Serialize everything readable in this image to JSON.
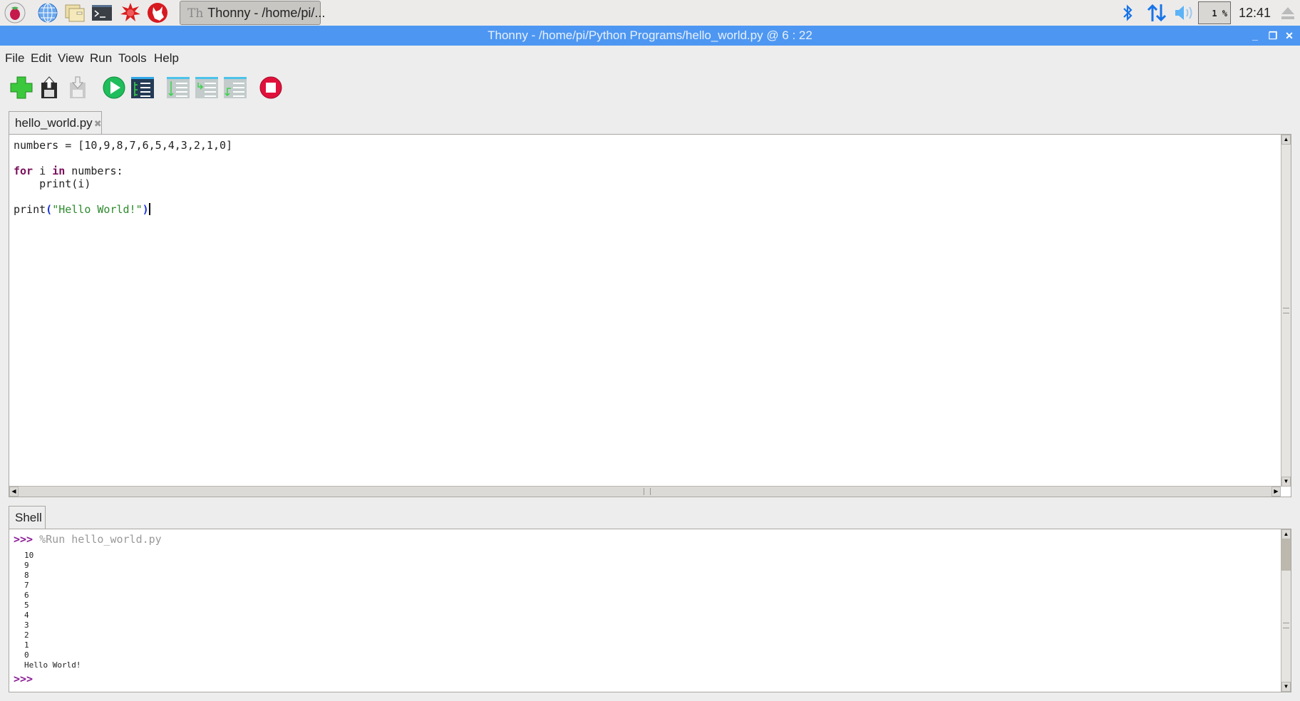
{
  "taskbar": {
    "launchers": [
      {
        "name": "raspberry-menu-icon"
      },
      {
        "name": "web-browser-icon"
      },
      {
        "name": "file-manager-icon"
      },
      {
        "name": "terminal-icon"
      },
      {
        "name": "mathematica-icon"
      },
      {
        "name": "wolfram-icon"
      }
    ],
    "active_task": "Thonny  -  /home/pi/...",
    "active_task_glyph": "Th",
    "cpu_usage": "1 %",
    "clock": "12:41",
    "tray_icons": [
      "bluetooth-icon",
      "network-icon",
      "volume-icon",
      "eject-icon"
    ]
  },
  "window": {
    "title": "Thonny  -  /home/pi/Python Programs/hello_world.py  @  6 : 22",
    "controls": {
      "minimize": "_",
      "restore": "❐",
      "close": "✕"
    }
  },
  "menu": [
    "File",
    "Edit",
    "View",
    "Run",
    "Tools",
    "Help"
  ],
  "toolbar": [
    {
      "name": "new-file-button",
      "tip": "New"
    },
    {
      "name": "open-file-button",
      "tip": "Load"
    },
    {
      "name": "save-file-button",
      "tip": "Save"
    },
    {
      "name": "run-button",
      "tip": "Run current script"
    },
    {
      "name": "debug-button",
      "tip": "Debug current script"
    },
    {
      "name": "step-over-button",
      "tip": "Step over"
    },
    {
      "name": "step-into-button",
      "tip": "Step into"
    },
    {
      "name": "step-out-button",
      "tip": "Step out"
    },
    {
      "name": "stop-button",
      "tip": "Stop"
    }
  ],
  "colors": {
    "accent": "#4d97f2",
    "keyword": "#7a0f5b",
    "string": "#2c8a2c",
    "prompt": "#8b1e96",
    "run": "#1fbd5b",
    "stop": "#e0113b"
  },
  "editor": {
    "tab_label": "hello_world.py",
    "tab_close": "✖",
    "lines": {
      "l1": "numbers = [10,9,8,7,6,5,4,3,2,1,0]",
      "l3_kw1": "for",
      "l3_mid": " i ",
      "l3_kw2": "in",
      "l3_rest": " numbers:",
      "l4": "    print(i)",
      "l6_fn": "print",
      "l6_open": "(",
      "l6_str": "\"Hello World!\"",
      "l6_close": ")"
    }
  },
  "shell": {
    "tab_label": "Shell",
    "prompt": ">>>",
    "command": " %Run hello_world.py",
    "output": [
      "10",
      "9",
      "8",
      "7",
      "6",
      "5",
      "4",
      "3",
      "2",
      "1",
      "0",
      "Hello World!"
    ]
  }
}
